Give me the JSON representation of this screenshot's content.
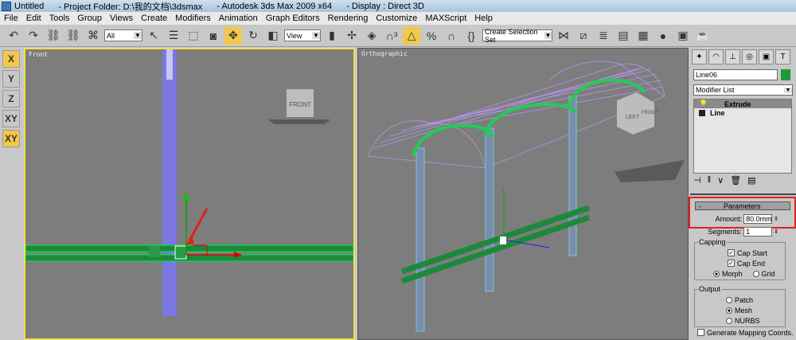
{
  "title": {
    "doc": "Untitled",
    "project": "- Project Folder: D:\\我的文档\\3dsmax",
    "app": "- Autodesk 3ds Max  2009 x64",
    "display": "- Display : Direct 3D"
  },
  "menu": [
    "File",
    "Edit",
    "Tools",
    "Group",
    "Views",
    "Create",
    "Modifiers",
    "Animation",
    "Graph Editors",
    "Rendering",
    "Customize",
    "MAXScript",
    "Help"
  ],
  "toolbar": {
    "filter": "All",
    "coord": "View",
    "selection_set": "Create Selection Set"
  },
  "axes": [
    "X",
    "Y",
    "Z",
    "XY",
    "XY"
  ],
  "viewports": {
    "left": {
      "label": "Front",
      "cube": "FRONT"
    },
    "right": {
      "label": "Orthographic",
      "cube_left": "LEFT",
      "cube_front": "FRONT"
    }
  },
  "panel": {
    "object_name": "Line06",
    "object_color": "#1e9a3c",
    "modifier_list": "Modifier List",
    "stack": [
      "Extrude",
      "Line"
    ],
    "rollout": "Parameters",
    "amount_label": "Amount:",
    "amount": "80.0mm",
    "segments_label": "Segments:",
    "segments": "1",
    "capping": "Capping",
    "cap_start": "Cap Start",
    "cap_end": "Cap End",
    "morph": "Morph",
    "grid": "Grid",
    "output": "Output",
    "patch": "Patch",
    "mesh": "Mesh",
    "nurbs": "NURBS",
    "gen_mapping": "Generate Mapping Coords."
  },
  "colors": {
    "highlight": "#f2c84b",
    "annotation": "#e02020",
    "selected_border": "#f0e24a"
  }
}
